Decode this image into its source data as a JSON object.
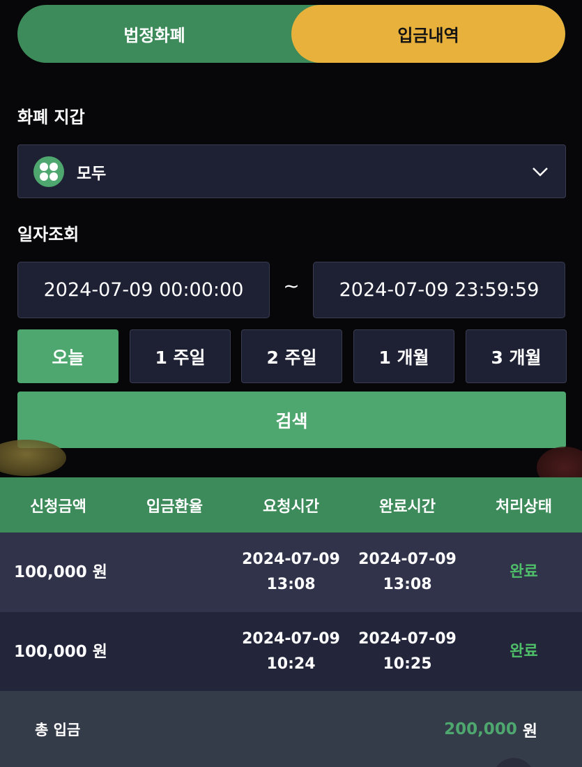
{
  "tabs": {
    "fiat": "법정화폐",
    "deposit_history": "입금내역"
  },
  "wallet": {
    "label": "화폐 지갑",
    "selected": "모두"
  },
  "date": {
    "label": "일자조회",
    "from": "2024-07-09 00:00:00",
    "separator": "~",
    "to": "2024-07-09 23:59:59"
  },
  "periods": [
    "오늘",
    "1 주일",
    "2 주일",
    "1 개월",
    "3 개월"
  ],
  "search_label": "검색",
  "table": {
    "headers": [
      "신청금액",
      "입금환율",
      "요청시간",
      "완료시간",
      "처리상태"
    ],
    "rows": [
      {
        "amount": "100,000 원",
        "rate": "",
        "request_date": "2024-07-09",
        "request_time": "13:08",
        "complete_date": "2024-07-09",
        "complete_time": "13:08",
        "status": "완료"
      },
      {
        "amount": "100,000 원",
        "rate": "",
        "request_date": "2024-07-09",
        "request_time": "10:24",
        "complete_date": "2024-07-09",
        "complete_time": "10:25",
        "status": "완료"
      }
    ]
  },
  "total": {
    "label": "총 입금",
    "value": "200,000",
    "unit": "원"
  },
  "colors": {
    "green": "#4ea76e",
    "yellow": "#e7b13c",
    "status_green": "#4fbf6a"
  }
}
